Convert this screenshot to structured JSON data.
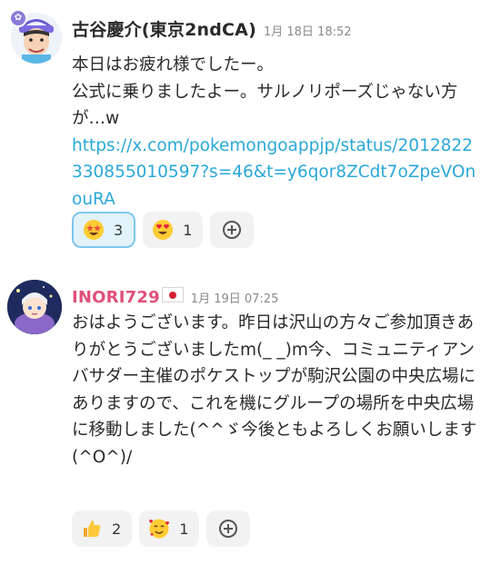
{
  "messages": [
    {
      "author": "古谷慶介(東京2ndCA)",
      "timestamp": "1月 18日 18:52",
      "text": "本日はお疲れ様でしたー。\n公式に乗りましたよー。サルノリポーズじゃない方が…w",
      "link": "https://x.com/pokemongoappjp/status/2012822330855010597?s=46&t=y6qor8ZCdt7oZpeVOnouRA",
      "avatar_icon": "man-avatar-icon",
      "badge_icon": "owner-badge-icon",
      "reactions": [
        {
          "emoji": "star-struck-emoji",
          "count": "3",
          "active": true
        },
        {
          "emoji": "heart-eyes-emoji",
          "count": "1",
          "active": false
        }
      ]
    },
    {
      "author": "INORI729",
      "flag_icon": "japan-flag-icon",
      "timestamp": "1月 19日 07:25",
      "text": "おはようございます。昨日は沢山の方々ご参加頂きありがとうございましたm(_ _)m今、コミュニティアンバサダー主催のポケストップが駒沢公園の中央広場にありますので、これを機にグループの場所を中央広場に移動しました(^^ゞ今後ともよろしくお願いします(^O^)/",
      "avatar_icon": "anime-character-avatar-icon",
      "reactions": [
        {
          "emoji": "thumbs-up-emoji",
          "count": "2",
          "active": false
        },
        {
          "emoji": "smiling-face-with-hearts-emoji",
          "count": "1",
          "active": false
        }
      ]
    }
  ],
  "colors": {
    "link": "#2aa8d8",
    "inori_name": "#e0507a",
    "active_reaction_bg": "#e2f2fb",
    "active_reaction_border": "#7fc6ec"
  }
}
